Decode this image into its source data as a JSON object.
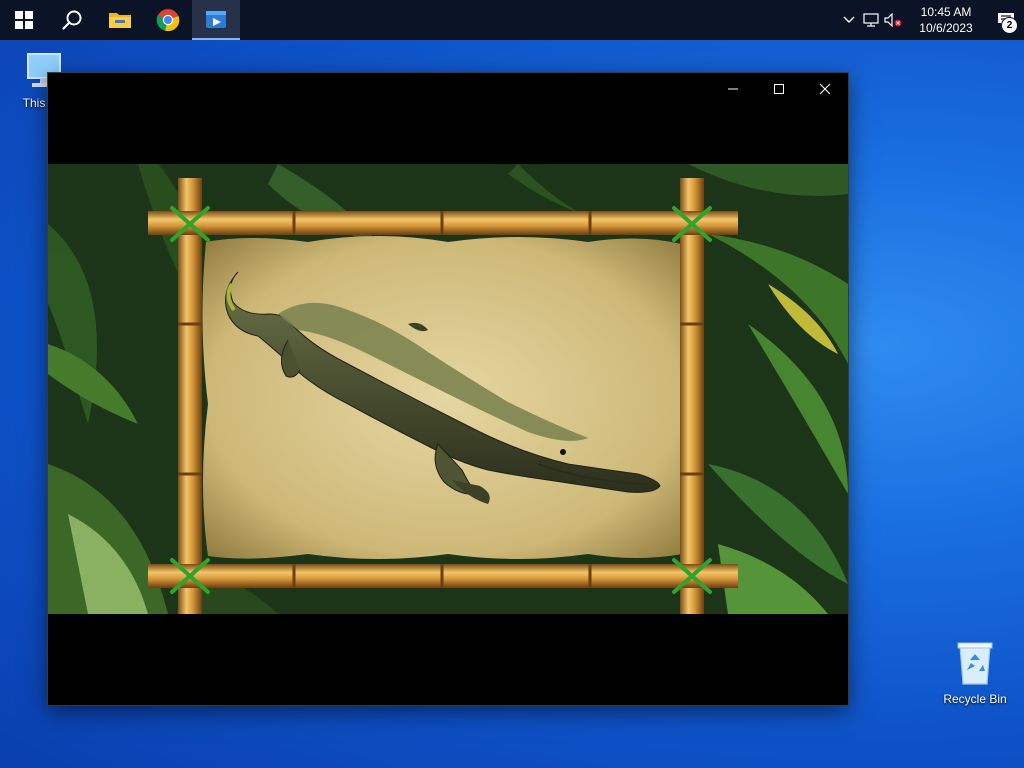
{
  "taskbar": {
    "apps": [
      {
        "name": "start-button",
        "icon": "windows-logo-icon"
      },
      {
        "name": "search-button",
        "icon": "search-icon"
      },
      {
        "name": "file-explorer-button",
        "icon": "folder-icon"
      },
      {
        "name": "chrome-button",
        "icon": "chrome-icon"
      },
      {
        "name": "media-player-button",
        "icon": "media-player-icon",
        "active": true
      }
    ],
    "clock": {
      "time": "10:45 AM",
      "date": "10/6/2023"
    },
    "notification_count": "2"
  },
  "desktop": {
    "this_pc_label": "This PC",
    "recycle_bin_label": "Recycle Bin"
  },
  "colors": {
    "taskbar": "#0b1427",
    "desktop_blue": "#1a6fe0",
    "bamboo": "#c9913a",
    "parchment": "#d6c48a",
    "jungle": "#1f3d1a"
  }
}
